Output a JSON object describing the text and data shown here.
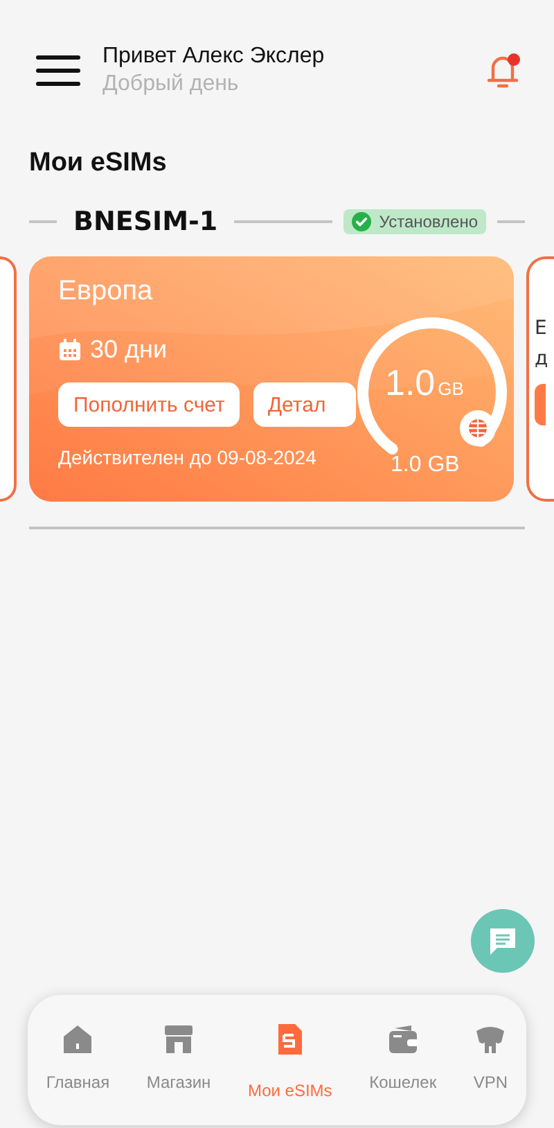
{
  "header": {
    "greeting": "Привет Алекс Экслер",
    "subtitle": "Добрый день",
    "has_notification": true
  },
  "page_title": "Мои eSIMs",
  "esim": {
    "name": "BNESIM-1",
    "status": "Установлено",
    "installed": true
  },
  "card": {
    "region": "Европа",
    "days": "30 дни",
    "topup_button": "Пополнить счет",
    "details_button": "Детал",
    "data_total": "1.0",
    "data_unit": "GB",
    "data_left": "1.0 GB",
    "level": 1,
    "valid_until": "Действителен до 09-08-2024"
  },
  "next_card": {
    "line_1": "Е",
    "line_2": "д"
  },
  "nav": [
    {
      "label": "Главная",
      "kind": "home",
      "selected": false
    },
    {
      "label": "Магазин",
      "kind": "store",
      "selected": false
    },
    {
      "label": "Мои eSIMs",
      "kind": "sim",
      "selected": true
    },
    {
      "label": "Кошелек",
      "kind": "wallet",
      "selected": false
    },
    {
      "label": "VPN",
      "kind": "vpn",
      "selected": false
    }
  ]
}
